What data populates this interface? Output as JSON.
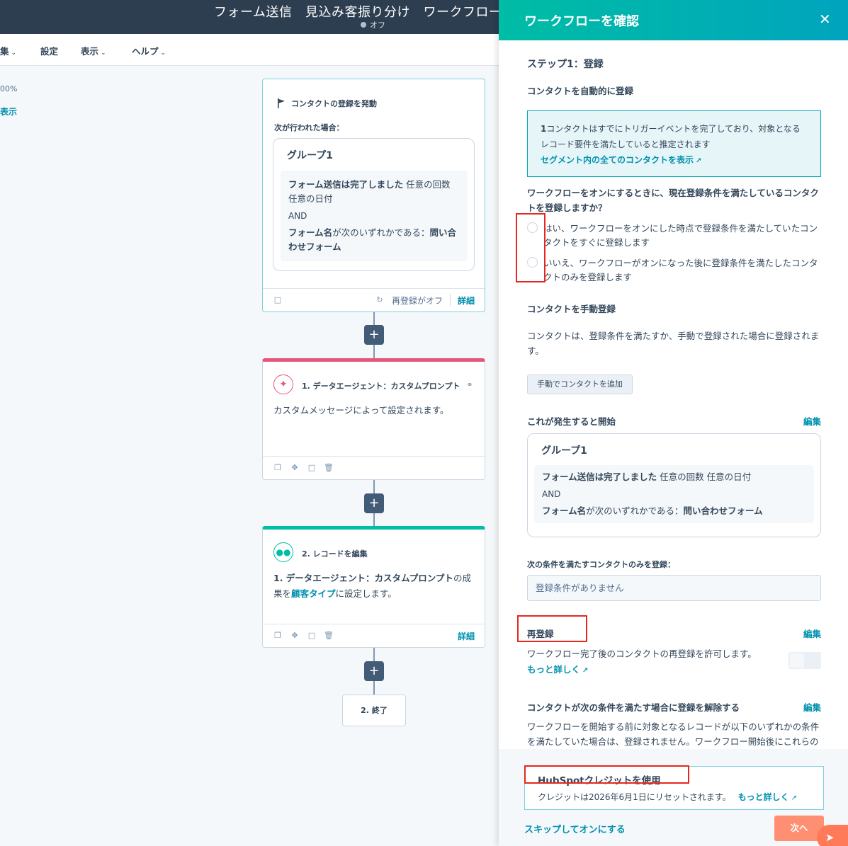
{
  "topbar": {
    "title": "フォーム送信　見込み客振り分け　ワークフロー",
    "status": "オフ"
  },
  "menu": {
    "edit": "集",
    "settings": "設定",
    "view": "表示",
    "help": "ヘルプ"
  },
  "canvas": {
    "zoom": "00%",
    "show": "表示"
  },
  "trigger_card": {
    "title": "コンタクトの登録を発動",
    "when": "次が行われた場合：",
    "group_title": "グループ1",
    "cond1_bold": "フォーム送信は完了しました",
    "cond1_rest": " 任意の回数 任意の日付",
    "and": "AND",
    "cond2_bold": "フォーム名",
    "cond2_mid": "が次のいずれかである：",
    "cond2_val": "問い合わせフォーム",
    "reenroll_status": "再登録がオフ",
    "detail": "詳細"
  },
  "action1": {
    "title": "1. データエージェント：カスタムプロンプト",
    "body": "カスタムメッセージによって設定されます。"
  },
  "action2": {
    "title": "2. レコードを編集",
    "body_bold": "1. データエージェント：カスタムプロンプト",
    "body_mid1": "の成果を",
    "body_link": "顧客タイプ",
    "body_mid2": "に設定します。",
    "detail": "詳細"
  },
  "end": {
    "label": "2. 終了"
  },
  "panel": {
    "title": "ワークフローを確認",
    "step": "ステップ1：登録",
    "auto_heading": "コンタクトを自動的に登録",
    "info_count": "1",
    "info_text": "コンタクトはすでにトリガーイベントを完了しており、対象となるレコード要件を満たしていると推定されます",
    "info_link": "セグメント内の全てのコンタクトを表示",
    "question": "ワークフローをオンにするときに、現在登録条件を満たしているコンタクトを登録しますか？",
    "radio_yes": "はい、ワークフローをオンにした時点で登録条件を満たしていたコンタクトをすぐに登録します",
    "radio_no": "いいえ、ワークフローがオンになった後に登録条件を満たしたコンタクトのみを登録します",
    "manual_heading": "コンタクトを手動登録",
    "manual_text": "コンタクトは、登録条件を満たすか、手動で登録された場合に登録されます。",
    "manual_button": "手動でコンタクトを追加",
    "start_heading": "これが発生すると開始",
    "edit": "編集",
    "group_title": "グループ1",
    "cond1_bold": "フォーム送信は完了しました",
    "cond1_rest": " 任意の回数 任意の日付",
    "and": "AND",
    "cond2_bold": "フォーム名",
    "cond2_mid": "が次のいずれかである：",
    "cond2_val": "問い合わせフォーム",
    "only_heading": "次の条件を満たすコンタクトのみを登録：",
    "no_conditions": "登録条件がありません",
    "reenroll_heading": "再登録",
    "reenroll_text": "ワークフロー完了後のコンタクトの再登録を許可します。",
    "more": "もっと詳しく",
    "unenroll_heading": "コンタクトが次の条件を満たす場合に登録を解除する",
    "unenroll_text": "ワークフローを開始する前に対象となるレコードが以下のいずれかの条件を満たしていた場合は、登録されません。ワークフロー開始後にこれらの"
  },
  "footer": {
    "credit_title": "HubSpotクレジットを使用",
    "credit_text": "クレジットは2026年6月1日にリセットされます。",
    "credit_more": "もっと詳しく",
    "skip": "スキップしてオンにする",
    "next": "次へ"
  },
  "icons": {
    "flag": "flag-icon",
    "close": "close-icon",
    "external": "external-link-icon",
    "sparkle": "sparkle-icon",
    "people": "people-icon"
  },
  "colors": {
    "accent": "#0091ae",
    "header_dark": "#2d3e50",
    "panel_header": "#00bda5",
    "next_button": "#ff8f73",
    "highlight": "#e5281f"
  }
}
